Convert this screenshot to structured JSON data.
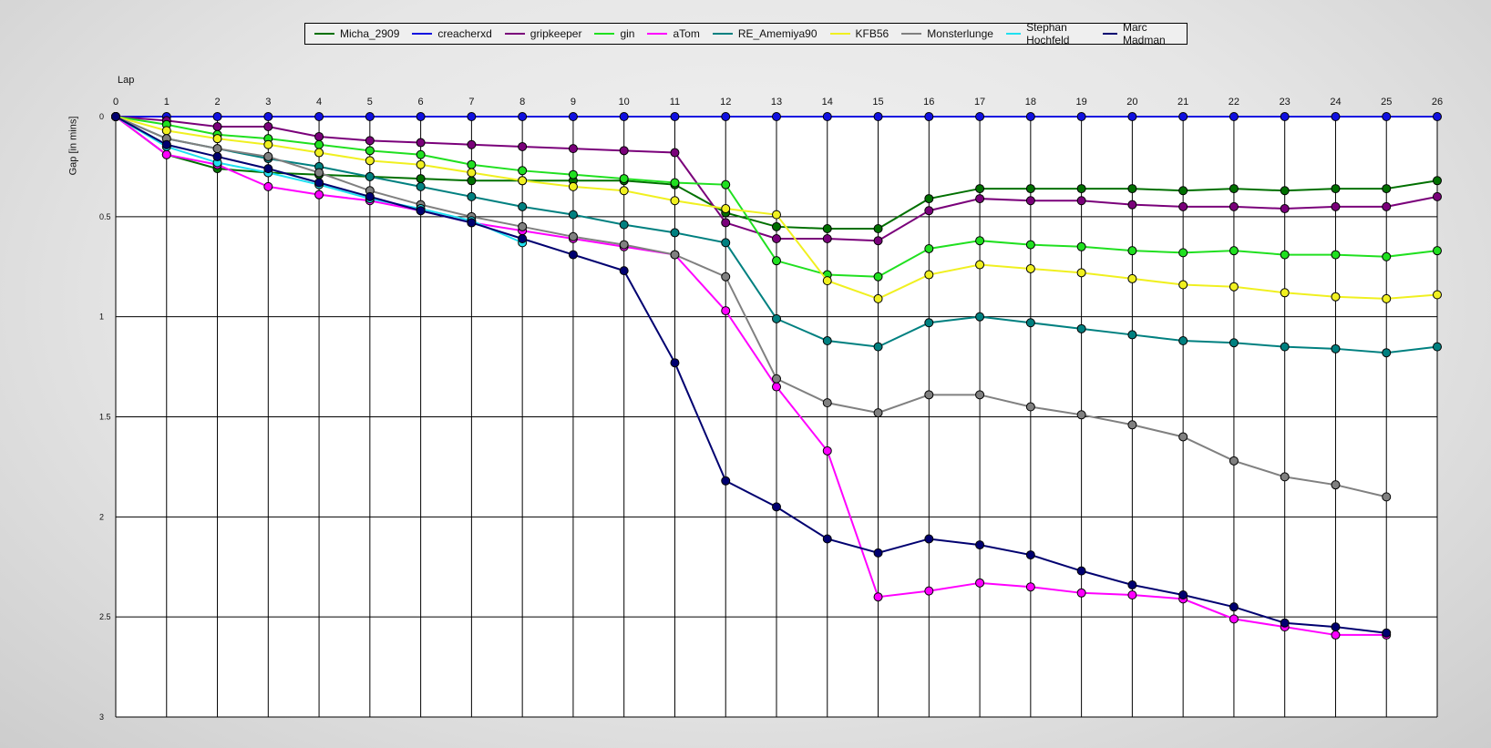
{
  "chart_data": {
    "type": "line",
    "title": "",
    "xlabel": "Lap",
    "ylabel": "Gap [in mins]",
    "x": [
      0,
      1,
      2,
      3,
      4,
      5,
      6,
      7,
      8,
      9,
      10,
      11,
      12,
      13,
      14,
      15,
      16,
      17,
      18,
      19,
      20,
      21,
      22,
      23,
      24,
      25,
      26
    ],
    "xlim": [
      0,
      26
    ],
    "ylim": [
      0,
      3
    ],
    "y_inverted": true,
    "yticks": [
      0,
      0.5,
      1,
      1.5,
      2,
      2.5,
      3
    ],
    "ytick_labels": [
      "0",
      "0.5",
      "1",
      "1.5",
      "2",
      "2.5",
      "3"
    ],
    "grid": true,
    "legend_position": "top-center",
    "background": "#ffffff",
    "series": [
      {
        "name": "Micha_2909",
        "color": "#007000",
        "values": [
          0,
          0.19,
          0.26,
          0.28,
          0.29,
          0.3,
          0.31,
          0.32,
          0.32,
          0.32,
          0.32,
          0.34,
          0.48,
          0.55,
          0.56,
          0.56,
          0.41,
          0.36,
          0.36,
          0.36,
          0.36,
          0.37,
          0.36,
          0.37,
          0.36,
          0.36,
          0.32
        ]
      },
      {
        "name": "creacherxd",
        "color": "#1010e0",
        "values": [
          0,
          0,
          0,
          0,
          0,
          0,
          0,
          0,
          0,
          0,
          0,
          0,
          0,
          0,
          0,
          0,
          0,
          0,
          0,
          0,
          0,
          0,
          0,
          0,
          0,
          0,
          0
        ]
      },
      {
        "name": "gripkeeper",
        "color": "#7a007a",
        "values": [
          0,
          0.02,
          0.05,
          0.05,
          0.1,
          0.12,
          0.13,
          0.14,
          0.15,
          0.16,
          0.17,
          0.18,
          0.53,
          0.61,
          0.61,
          0.62,
          0.47,
          0.41,
          0.42,
          0.42,
          0.44,
          0.45,
          0.45,
          0.46,
          0.45,
          0.45,
          0.4
        ]
      },
      {
        "name": "gin",
        "color": "#20e020",
        "values": [
          0,
          0.04,
          0.09,
          0.11,
          0.14,
          0.17,
          0.19,
          0.24,
          0.27,
          0.29,
          0.31,
          0.33,
          0.34,
          0.72,
          0.79,
          0.8,
          0.66,
          0.62,
          0.64,
          0.65,
          0.67,
          0.68,
          0.67,
          0.69,
          0.69,
          0.7,
          0.67
        ]
      },
      {
        "name": "aTom",
        "color": "#ff00ff",
        "values": [
          0,
          0.19,
          0.24,
          0.35,
          0.39,
          0.42,
          0.47,
          0.53,
          0.57,
          0.61,
          0.65,
          0.69,
          0.97,
          1.35,
          1.67,
          2.4,
          2.37,
          2.33,
          2.35,
          2.38,
          2.39,
          2.41,
          2.51,
          2.55,
          2.59,
          2.59,
          null
        ]
      },
      {
        "name": "RE_Amemiya90",
        "color": "#008080",
        "values": [
          0,
          0.11,
          0.16,
          0.21,
          0.25,
          0.3,
          0.35,
          0.4,
          0.45,
          0.49,
          0.54,
          0.58,
          0.63,
          1.01,
          1.12,
          1.15,
          1.03,
          1.0,
          1.03,
          1.06,
          1.09,
          1.12,
          1.13,
          1.15,
          1.16,
          1.18,
          1.15
        ]
      },
      {
        "name": "KFB56",
        "color": "#f0f020",
        "values": [
          0,
          0.07,
          0.11,
          0.14,
          0.18,
          0.22,
          0.24,
          0.28,
          0.32,
          0.35,
          0.37,
          0.42,
          0.46,
          0.49,
          0.82,
          0.91,
          0.79,
          0.74,
          0.76,
          0.78,
          0.81,
          0.84,
          0.85,
          0.88,
          0.9,
          0.91,
          0.89
        ]
      },
      {
        "name": "Monsterlunge",
        "color": "#808080",
        "values": [
          0,
          0.11,
          0.16,
          0.2,
          0.28,
          0.37,
          0.44,
          0.5,
          0.55,
          0.6,
          0.64,
          0.69,
          0.8,
          1.31,
          1.43,
          1.48,
          1.39,
          1.39,
          1.45,
          1.49,
          1.54,
          1.6,
          1.72,
          1.8,
          1.84,
          1.9,
          null
        ]
      },
      {
        "name": "Stephan Hochfeld",
        "color": "#20e0f0",
        "values": [
          0,
          0.15,
          0.23,
          0.28,
          0.34,
          0.41,
          0.46,
          0.52,
          0.63,
          null,
          null,
          null,
          null,
          null,
          null,
          null,
          null,
          null,
          null,
          null,
          null,
          null,
          null,
          null,
          null,
          null,
          null
        ]
      },
      {
        "name": "Marc Madman",
        "color": "#000070",
        "values": [
          0,
          0.14,
          0.2,
          0.26,
          0.33,
          0.4,
          0.47,
          0.53,
          0.61,
          0.69,
          0.77,
          1.23,
          1.82,
          1.95,
          2.11,
          2.18,
          2.11,
          2.14,
          2.19,
          2.27,
          2.34,
          2.39,
          2.45,
          2.53,
          2.55,
          2.58,
          null
        ]
      }
    ]
  }
}
